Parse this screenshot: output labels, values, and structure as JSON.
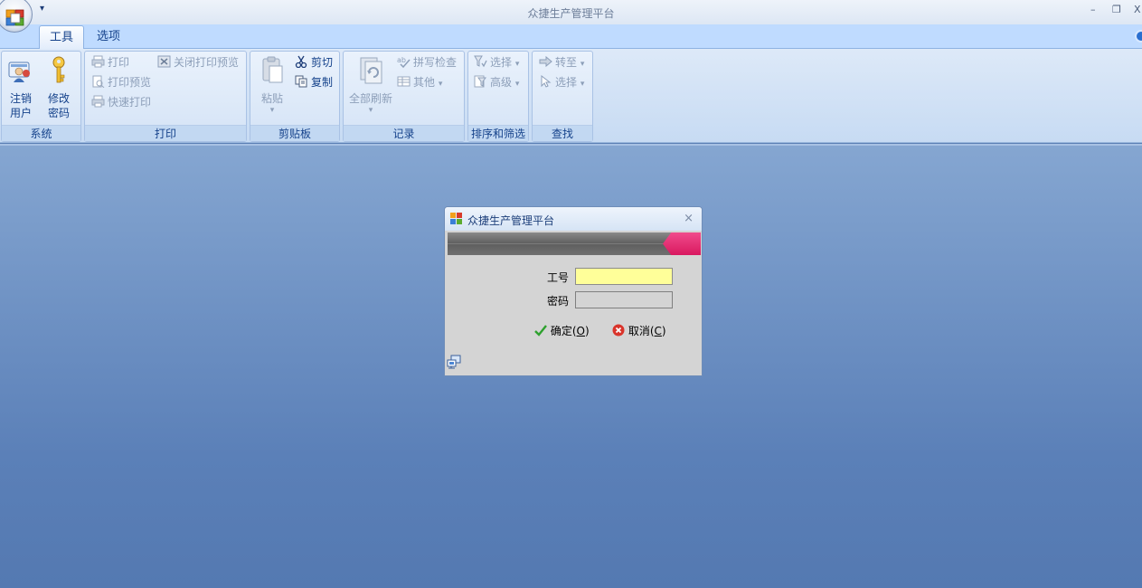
{
  "window": {
    "title": "众捷生产管理平台",
    "controls": {
      "minimize": "–",
      "restore": "❐",
      "close": "X"
    }
  },
  "ribbon": {
    "tabs": [
      {
        "label": "工具",
        "active": true
      },
      {
        "label": "选项",
        "active": false
      }
    ],
    "groups": {
      "system": {
        "label": "系统",
        "logout_line1": "注销",
        "logout_line2": "用户",
        "change_pwd_line1": "修改",
        "change_pwd_line2": "密码"
      },
      "print": {
        "label": "打印",
        "print": "打印",
        "preview": "打印预览",
        "quick_print": "快速打印",
        "close_preview": "关闭打印预览"
      },
      "clipboard": {
        "label": "剪贴板",
        "paste": "粘贴",
        "cut": "剪切",
        "copy": "复制"
      },
      "records": {
        "label": "记录",
        "refresh_all": "全部刷新",
        "spell_check": "拼写检查",
        "other": "其他"
      },
      "sort_filter": {
        "label": "排序和筛选",
        "select": "选择",
        "advanced": "高级"
      },
      "find": {
        "label": "查找",
        "goto": "转至",
        "select": "选择"
      }
    }
  },
  "dialog": {
    "title": "众捷生产管理平台",
    "close_glyph": "×",
    "user_id_label": "工号",
    "user_id_value": "",
    "password_label": "密码",
    "password_value": "",
    "ok_label": "确定",
    "ok_hotkey": "O",
    "cancel_label": "取消",
    "cancel_hotkey": "C"
  },
  "colors": {
    "accent": "#15428b",
    "ribbon_bg": "#dde9f8",
    "workspace": "#5b80b8",
    "input_highlight": "#ffff99",
    "banner_pink": "#e91e63"
  }
}
